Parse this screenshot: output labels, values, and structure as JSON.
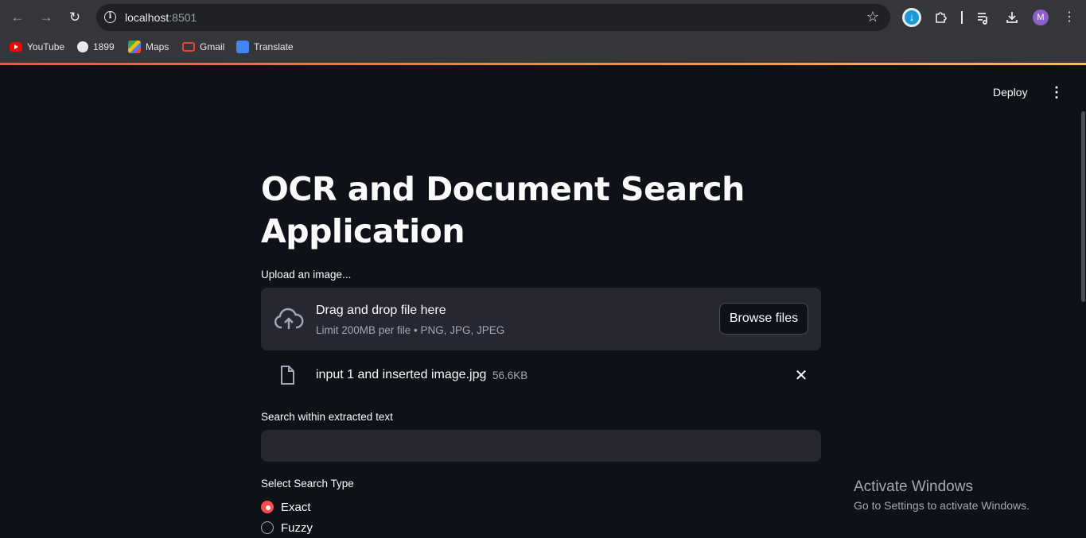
{
  "browser": {
    "url_host": "localhost",
    "url_port": ":8501",
    "avatar_letter": "M",
    "bookmarks": [
      {
        "label": "YouTube",
        "icon": "youtube-icon"
      },
      {
        "label": "1899",
        "icon": "globe-icon"
      },
      {
        "label": "Maps",
        "icon": "maps-icon"
      },
      {
        "label": "Gmail",
        "icon": "gmail-icon"
      },
      {
        "label": "Translate",
        "icon": "translate-icon"
      }
    ],
    "accent_gradient": [
      "#ff4b4b",
      "#ffbd45"
    ]
  },
  "app": {
    "deploy_label": "Deploy",
    "title": "OCR and Document Search Application",
    "upload": {
      "label": "Upload an image...",
      "drop_title": "Drag and drop file here",
      "drop_sub": "Limit 200MB per file • PNG, JPG, JPEG",
      "browse_label": "Browse files"
    },
    "uploaded_file": {
      "name": "input 1 and inserted image.jpg",
      "size": "56.6KB"
    },
    "search": {
      "label": "Search within extracted text",
      "value": ""
    },
    "search_type": {
      "label": "Select Search Type",
      "options": [
        "Exact",
        "Fuzzy"
      ],
      "selected": "Exact"
    },
    "accent_color": "#ff4b4b"
  },
  "watermark": {
    "title": "Activate Windows",
    "subtitle": "Go to Settings to activate Windows."
  }
}
